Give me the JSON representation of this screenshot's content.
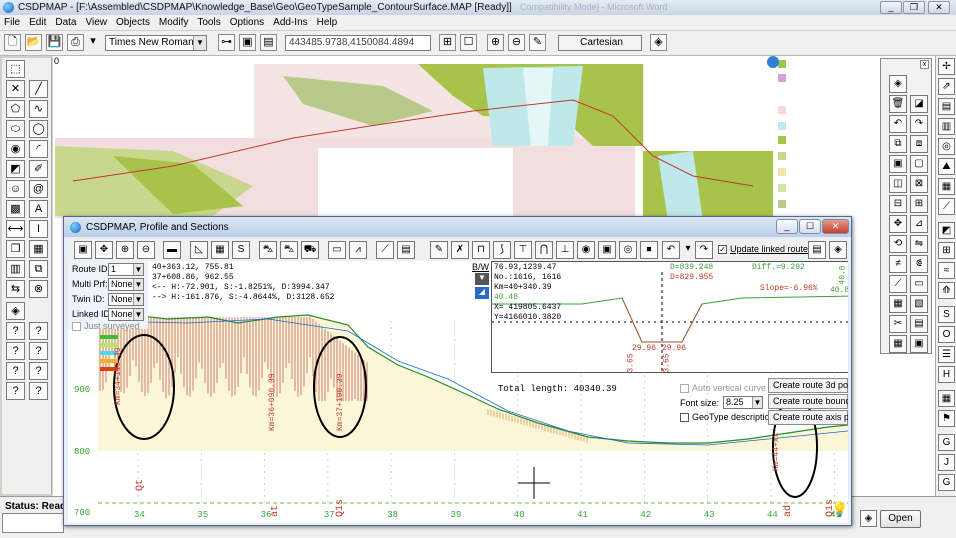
{
  "app": {
    "title": "CSDPMAP - [F:\\Assembled\\CSDPMAP\\Knowledge_Base\\Geo\\GeoTypeSample_ContourSurface.MAP [Ready]]",
    "title_ghost": "Compatibility Mode] - Microsoft Word"
  },
  "menu": [
    "File",
    "Edit",
    "Data",
    "View",
    "Objects",
    "Modify",
    "Tools",
    "Options",
    "Add-Ins",
    "Help"
  ],
  "toolbar": {
    "font": "Times New Roman",
    "coords": "443485.9738,4150084.4894",
    "projection": "Cartesian"
  },
  "map": {
    "origin_label": "0"
  },
  "status": {
    "label": "Status: Ready"
  },
  "open_button": "Open",
  "dialog": {
    "title": "CSDPMAP, Profile and Sections",
    "update_linked": "Update linked routes",
    "route_id_label": "Route ID:",
    "route_id": "1",
    "multi_prf_label": "Multi Prf:",
    "multi_prf": "None",
    "twin_id_label": "Twin ID:",
    "twin_id": "None",
    "linked_id_label": "Linked ID:",
    "linked_id": "None",
    "just_surveyed": "Just surveyed",
    "bw": "B/W",
    "readout": [
      "40+363.12, 755.81",
      "37+608.86, 962.55",
      "<-- H:-72.901, S:-1.8251%, D:3994.347",
      "--> H:-161.876, S:-4.8644%, D:3128.652"
    ],
    "section": {
      "lines": [
        "76.93,1239.47",
        "No.:1616, 1616",
        "Km=40+340.39",
        "40.48"
      ],
      "xy": [
        "X= 419805.6437",
        "Y=4166010.3820"
      ],
      "d1": "D=839.248",
      "d2": "D=829.955",
      "diff": "Diff.=9.292",
      "slope": "Slope=-6.96%",
      "r1": "40.0",
      "r2": "40.8",
      "w1": "29.96",
      "w2": "29.96",
      "h1": "3.65",
      "h2": "3.65"
    },
    "total_length": "Total length: 40340.39",
    "auto_vertical_curve": "Auto vertical curve",
    "font_size_label": "Font size:",
    "font_size": "8.25",
    "geotype_description": "GeoType description",
    "btn_3d_points": "Create route 3d points",
    "btn_boundary": "Create route boundary",
    "btn_axis_poly": "Create route axis poly",
    "elev_labels": [
      "900",
      "800",
      "700"
    ],
    "km_ticks": [
      "34",
      "35",
      "36",
      "37",
      "38",
      "39",
      "40",
      "41",
      "42",
      "43",
      "44",
      "45"
    ],
    "station_labels": [
      "Km=34+115.39",
      "Km=36+090.39",
      "Km=37+190.39",
      "Km=44+xx"
    ],
    "geo_labels": [
      "Qt",
      "at",
      "Q1s",
      "ad",
      "Q1s"
    ]
  },
  "colors": {
    "map_green": "#a8c34a",
    "map_pink": "#f4dada",
    "map_cyan": "#bfe8ea",
    "route_red": "#c0392b",
    "profile_hatch": "#b03030",
    "section_green": "#3aa23a"
  }
}
